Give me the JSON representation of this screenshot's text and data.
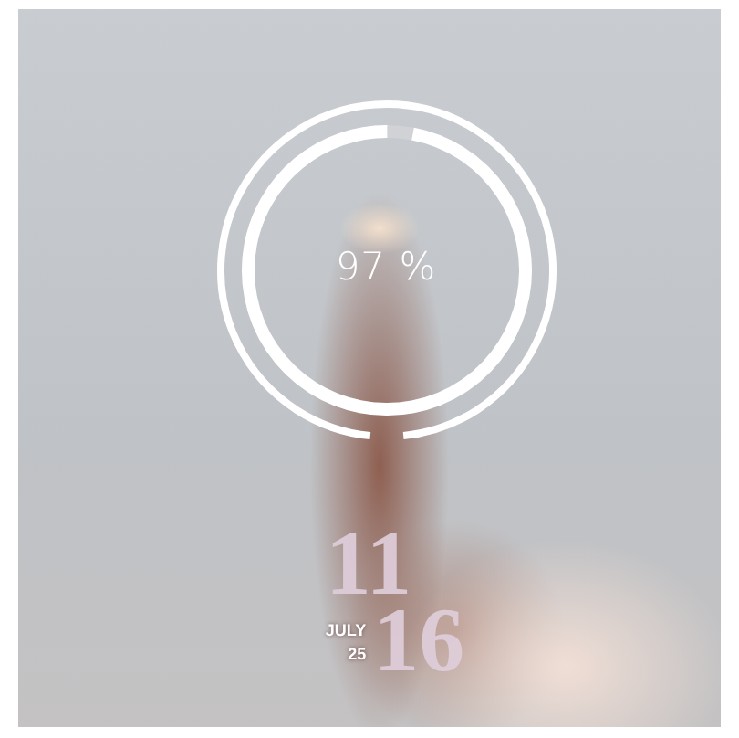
{
  "battery": {
    "reading": "97 %",
    "level": 0.97
  },
  "clock": {
    "hour": "11",
    "minute": "16",
    "month": "JULY",
    "day": "25"
  }
}
